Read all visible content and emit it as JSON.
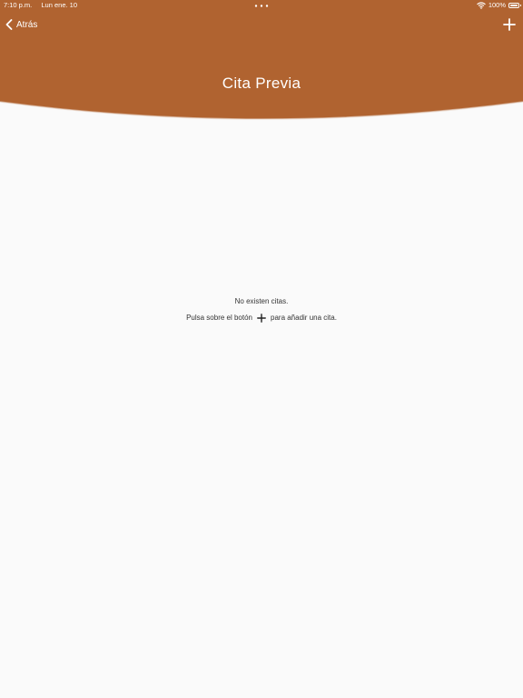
{
  "colors": {
    "header_bg": "#b06330",
    "content_bg": "#fafafa",
    "header_text": "#ffffff",
    "body_text": "#333333"
  },
  "status_bar": {
    "time": "7:10 p.m.",
    "date": "Lun ene. 10",
    "battery_text": "100%",
    "battery_level_percent": 100
  },
  "nav": {
    "back_label": "Atrás",
    "back_icon": "chevron-left-icon",
    "add_icon": "plus-icon"
  },
  "header": {
    "title": "Cita Previa"
  },
  "empty_state": {
    "title": "No existen citas.",
    "hint_before": "Pulsa sobre el botón",
    "hint_icon": "plus-icon",
    "hint_after": "para añadir una cita."
  }
}
